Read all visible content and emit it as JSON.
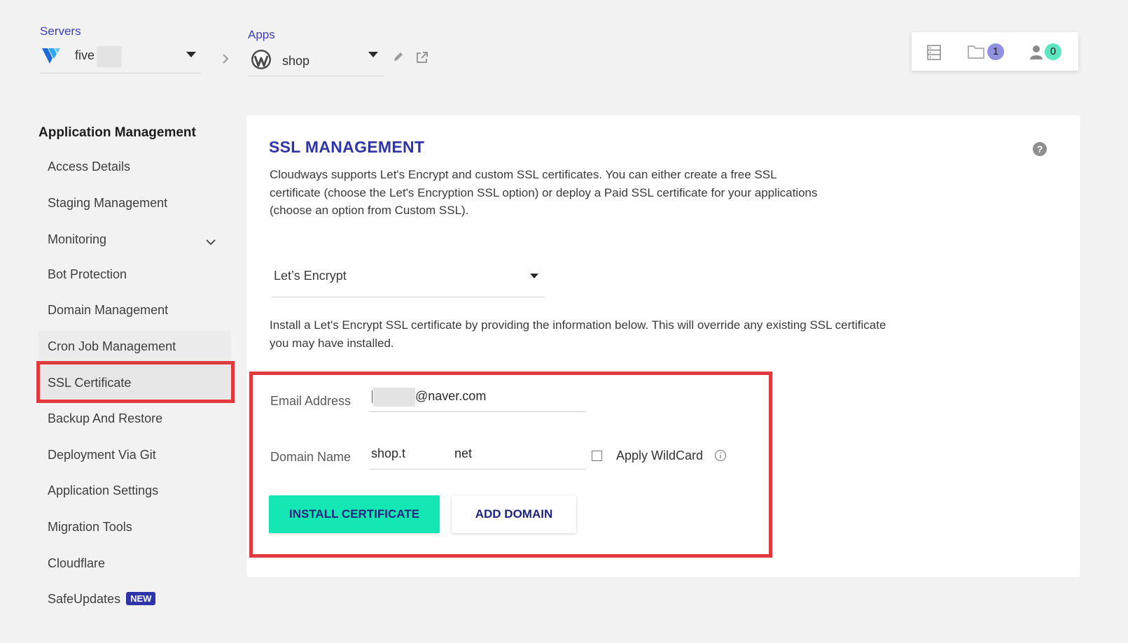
{
  "breadcrumb": {
    "servers_label": "Servers",
    "server_name": "five",
    "apps_label": "Apps",
    "app_name": "shop"
  },
  "topbar": {
    "projects_count": "1",
    "users_count": "0",
    "projects_badge_color": "#8f91e0",
    "users_badge_color": "#5ee6c1"
  },
  "sidebar": {
    "heading": "Application Management",
    "items": [
      "Access Details",
      "Staging Management",
      "Monitoring",
      "Bot Protection",
      "Domain Management",
      "Cron Job Management",
      "SSL Certificate",
      "Backup And Restore",
      "Deployment Via Git",
      "Application Settings",
      "Migration Tools",
      "Cloudflare",
      "SafeUpdates"
    ],
    "new_badge": "NEW",
    "active_item": "SSL Certificate"
  },
  "main": {
    "title": "SSL MANAGEMENT",
    "description": "Cloudways supports Let's Encrypt and custom SSL certificates. You can either create a free SSL certificate (choose the Let's Encryption SSL option) or deploy a Paid SSL certificate for your applications (choose an option from Custom SSL).",
    "ssl_type": "Let’s Encrypt",
    "install_note": "Install a Let's Encrypt SSL certificate by providing the information below. This will override any existing SSL certificate you may have installed.",
    "email_label": "Email Address",
    "email_value": "@naver.com",
    "domain_label": "Domain Name",
    "domain_value_start": "shop.t",
    "domain_value_end": "net",
    "wildcard_label": "Apply WildCard",
    "install_button": "INSTALL CERTIFICATE",
    "add_domain_button": "ADD DOMAIN"
  },
  "colors": {
    "accent": "#2f35a8",
    "primary_button": "#14e7b3",
    "highlight": "#e03a3f"
  }
}
